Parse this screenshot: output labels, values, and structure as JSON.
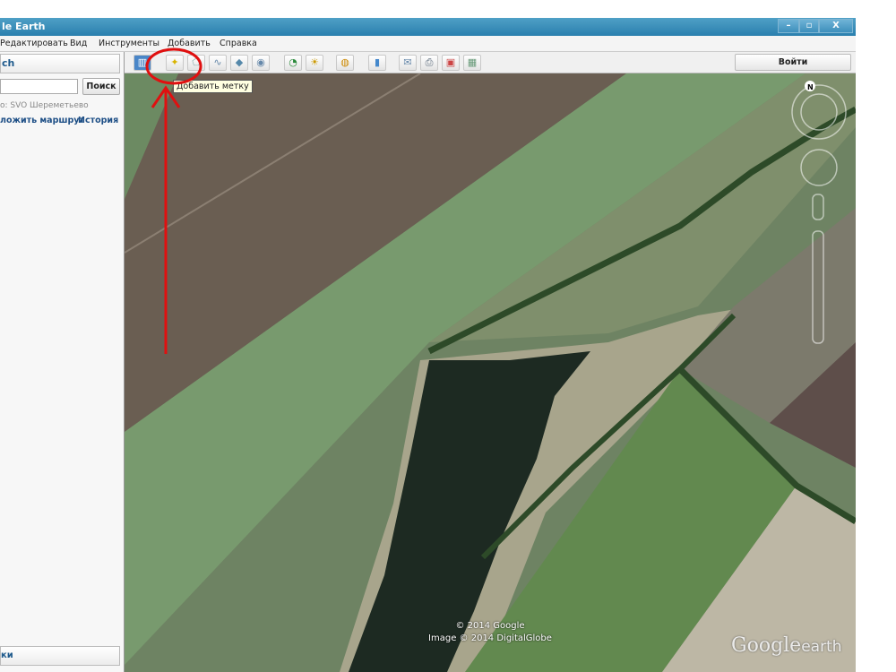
{
  "window": {
    "title": "le Earth",
    "minimize": "–",
    "restore": "▫",
    "close": "X"
  },
  "menu": [
    "Редактировать",
    "Вид",
    "Инструменты",
    "Добавить",
    "Справка"
  ],
  "toolbar": {
    "login": "Войти",
    "tooltip": "Добавить метку",
    "icons": [
      "sidebar-icon",
      "placemark-icon",
      "polygon-icon",
      "path-icon",
      "overlay-icon",
      "tour-icon",
      "history-icon",
      "sun-icon",
      "planet-icon",
      "ruler-icon",
      "email-icon",
      "print-icon",
      "google-maps-icon",
      "kml-icon"
    ]
  },
  "left": {
    "search_tab": "ch",
    "search_value": "",
    "search_button": "Поиск",
    "hint": "о: SVO Шереметьево",
    "link_route": "ложить маршрут",
    "link_history": "История",
    "places_tab": "ки"
  },
  "map": {
    "compass_label": "N",
    "copyright1": "© 2014 Google",
    "copyright2": "Image © 2014 DigitalGlobe",
    "logo_main": "Google",
    "logo_sub": "earth"
  },
  "annotation_color": "#e01010"
}
